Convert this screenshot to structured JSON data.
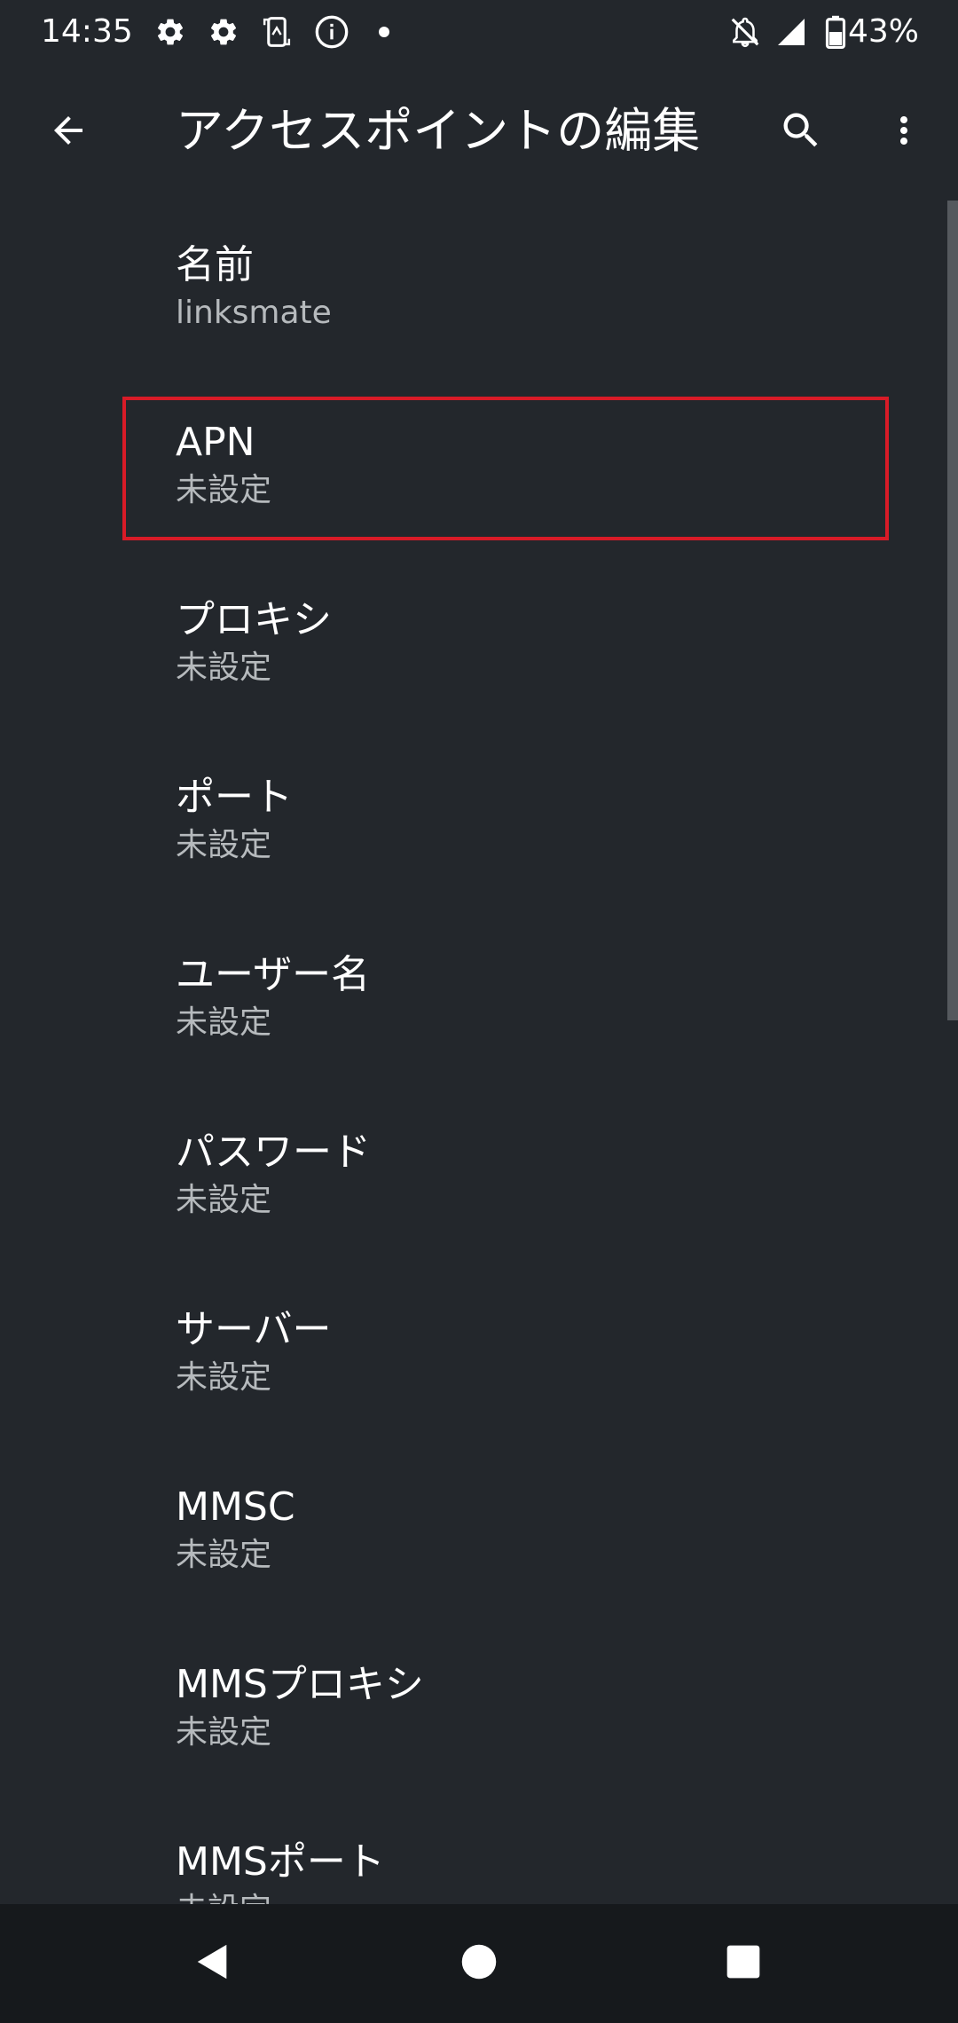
{
  "status_bar": {
    "time": "14:35",
    "battery_percent": "43%",
    "icons_left": [
      "gear-icon",
      "gear-icon",
      "phone-screen-icon",
      "info-icon",
      "dot-icon"
    ],
    "icons_right": [
      "notifications-off-icon",
      "signal-icon",
      "battery-icon"
    ]
  },
  "app_bar": {
    "title": "アクセスポイントの編集",
    "back_icon": "arrow-back-icon",
    "search_icon": "search-icon",
    "more_icon": "more-vert-icon"
  },
  "settings": {
    "items": [
      {
        "title": "名前",
        "summary": "linksmate"
      },
      {
        "title": "APN",
        "summary": "未設定"
      },
      {
        "title": "プロキシ",
        "summary": "未設定"
      },
      {
        "title": "ポート",
        "summary": "未設定"
      },
      {
        "title": "ユーザー名",
        "summary": "未設定"
      },
      {
        "title": "パスワード",
        "summary": "未設定"
      },
      {
        "title": "サーバー",
        "summary": "未設定"
      },
      {
        "title": "MMSC",
        "summary": "未設定"
      },
      {
        "title": "MMSプロキシ",
        "summary": "未設定"
      },
      {
        "title": "MMSポート",
        "summary": "未設定"
      }
    ]
  },
  "nav_bar": {
    "back_icon": "nav-back-icon",
    "home_icon": "nav-home-icon",
    "recents_icon": "nav-recents-icon"
  },
  "colors": {
    "background": "#23272c",
    "highlight": "#d81b27",
    "summary_text": "#b6babd",
    "nav_bar": "#16191c"
  }
}
